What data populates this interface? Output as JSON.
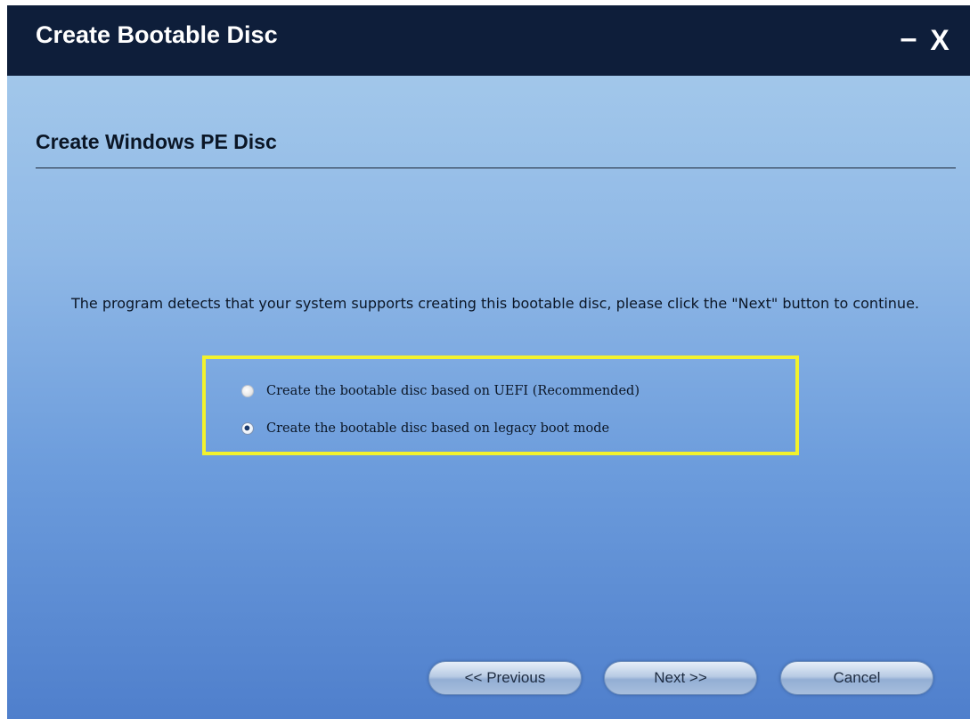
{
  "window": {
    "title": "Create Bootable Disc",
    "minimize_label": "–",
    "close_label": "X"
  },
  "page": {
    "section_title": "Create Windows PE Disc",
    "message": "The program detects that your system supports creating this bootable disc, please click the \"Next\" button to continue."
  },
  "options": [
    {
      "label": "Create the bootable disc based on UEFI (Recommended)",
      "selected": false
    },
    {
      "label": "Create the bootable disc based on legacy boot mode",
      "selected": true
    }
  ],
  "buttons": {
    "previous": "<< Previous",
    "next": "Next >>",
    "cancel": "Cancel"
  },
  "colors": {
    "titlebar": "#0e1e3a",
    "highlight_border": "#f2f22d"
  }
}
